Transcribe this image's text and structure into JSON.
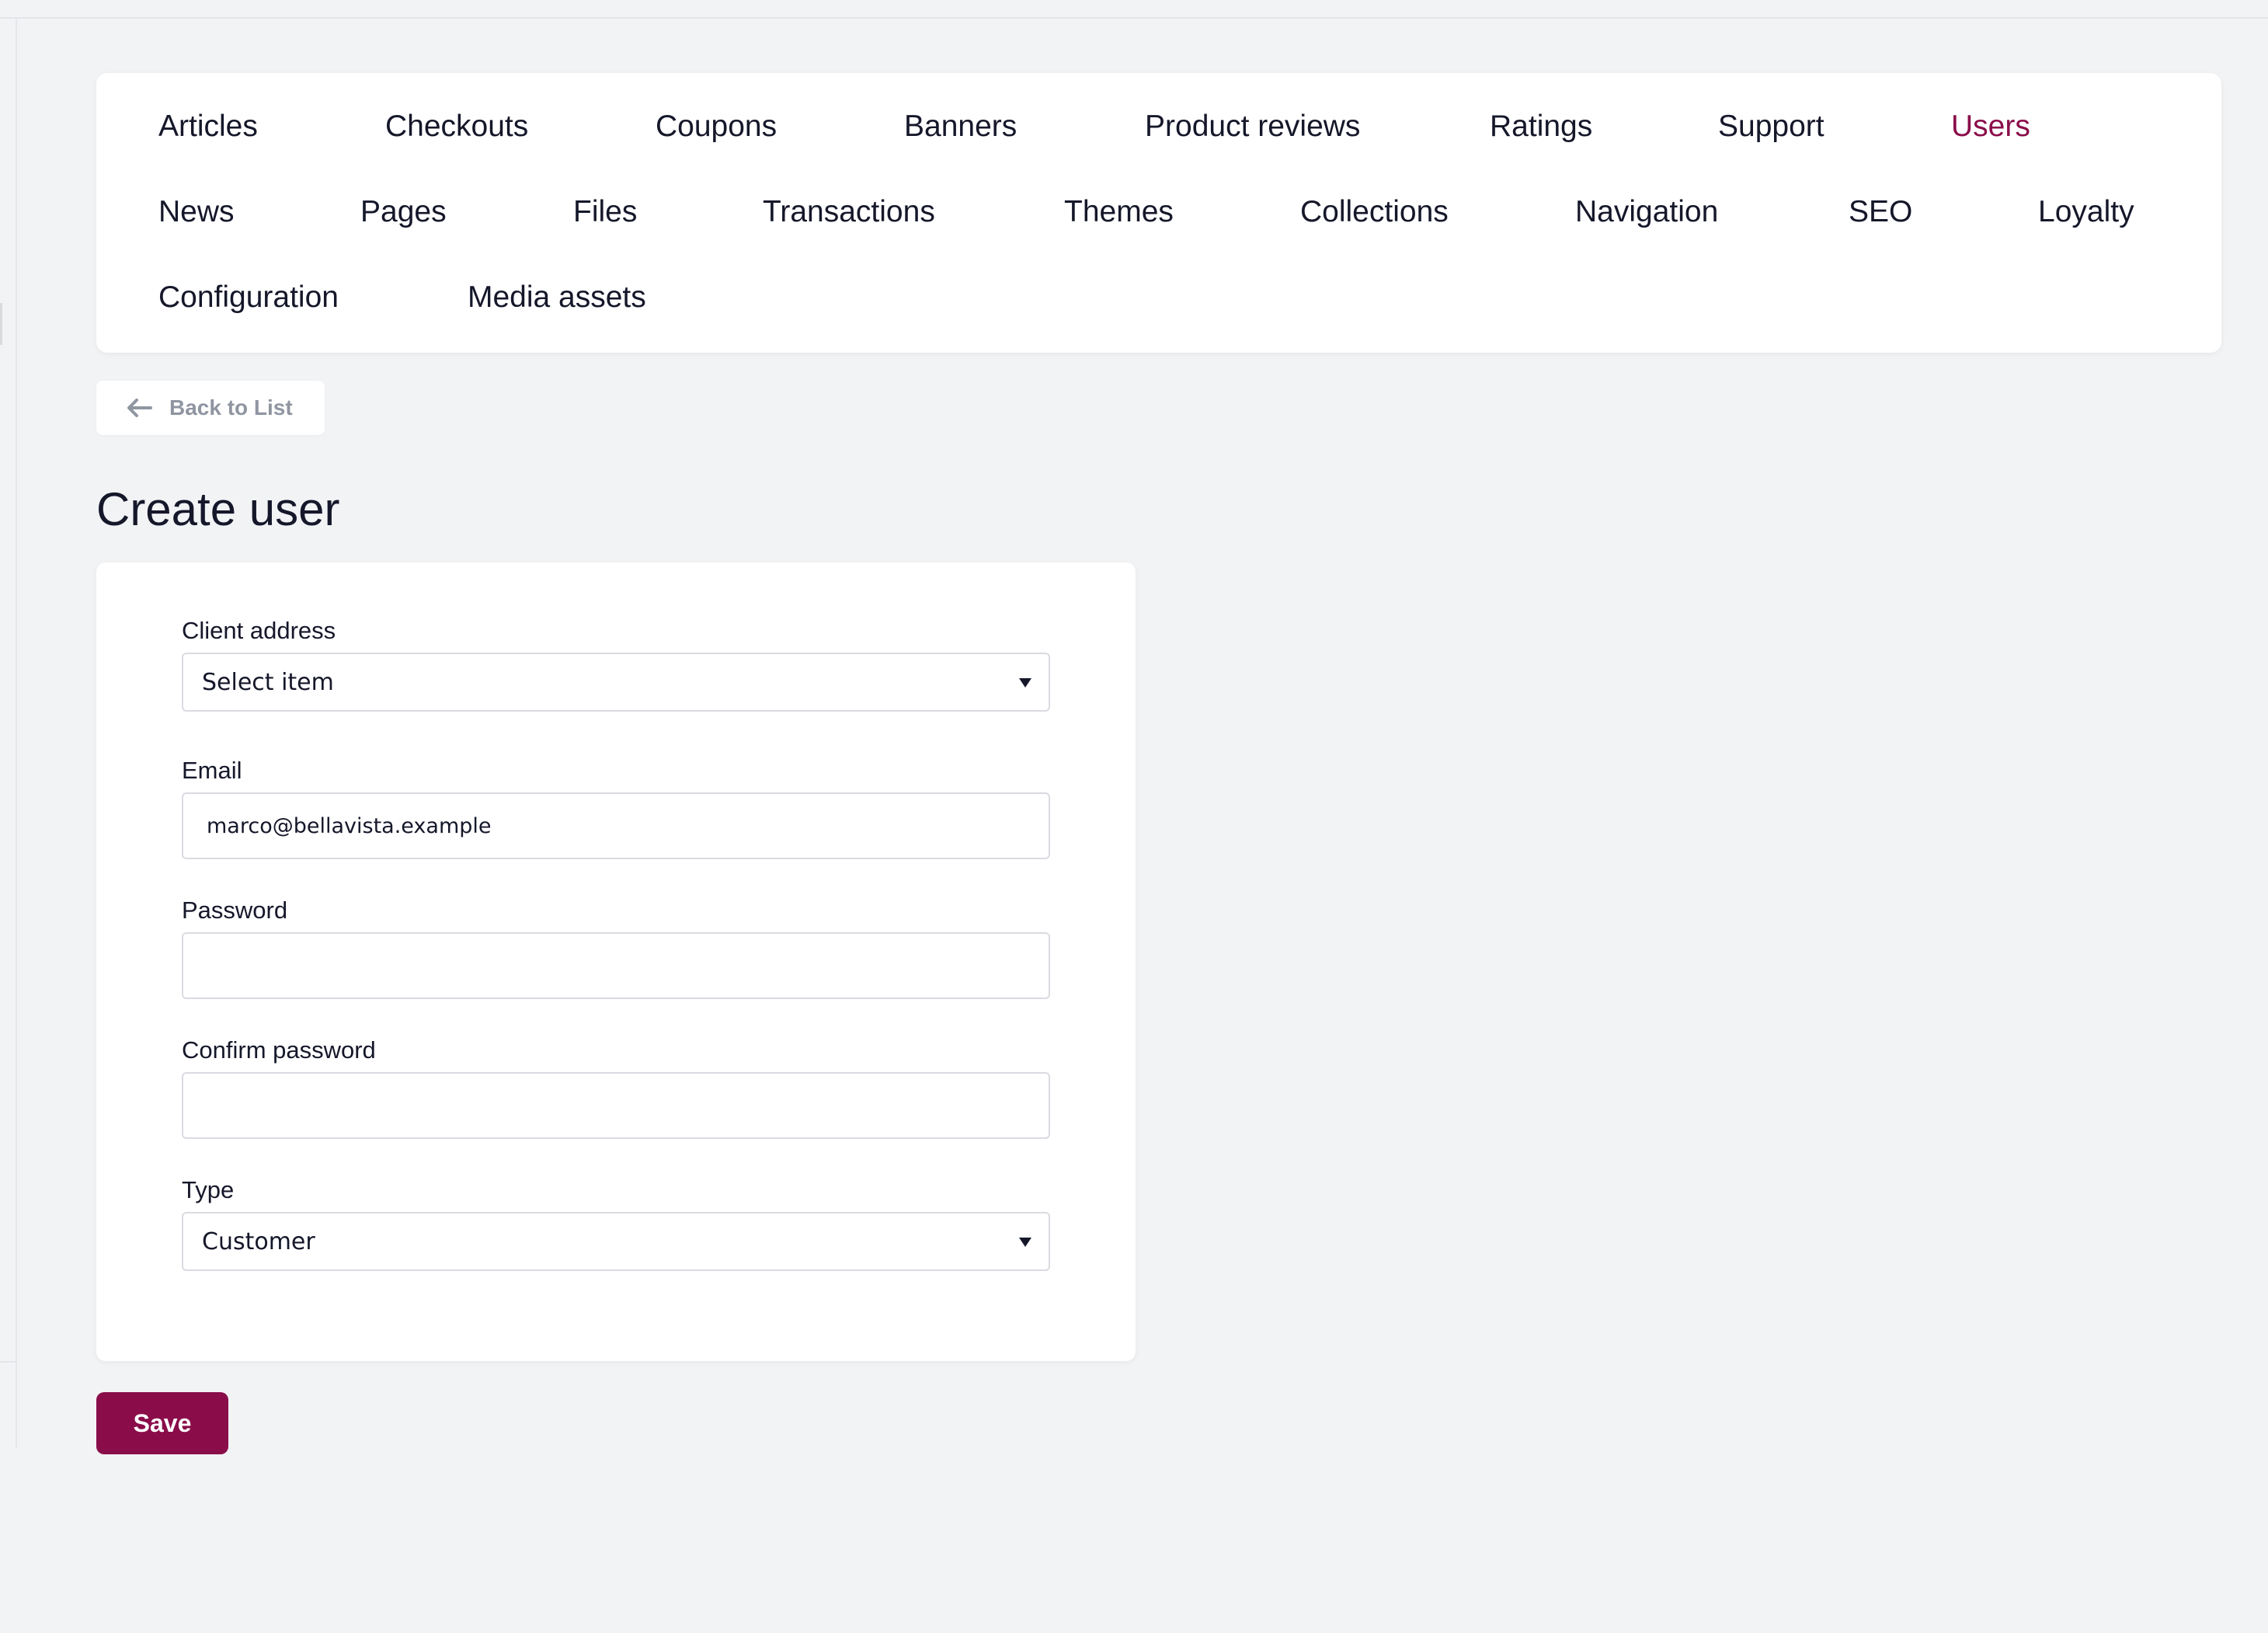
{
  "nav": {
    "items": [
      {
        "label": "Articles"
      },
      {
        "label": "Checkouts"
      },
      {
        "label": "Coupons"
      },
      {
        "label": "Banners"
      },
      {
        "label": "Product reviews"
      },
      {
        "label": "Ratings"
      },
      {
        "label": "Support"
      },
      {
        "label": "Users",
        "active": true
      },
      {
        "label": "News"
      },
      {
        "label": "Pages"
      },
      {
        "label": "Files"
      },
      {
        "label": "Transactions"
      },
      {
        "label": "Themes"
      },
      {
        "label": "Collections"
      },
      {
        "label": "Navigation"
      },
      {
        "label": "SEO"
      },
      {
        "label": "Loyalty"
      },
      {
        "label": "Configuration"
      },
      {
        "label": "Media assets"
      }
    ]
  },
  "back_button": {
    "label": "Back to List",
    "icon": "arrow-left-icon"
  },
  "page": {
    "title": "Create user"
  },
  "form": {
    "client_address": {
      "label": "Client address",
      "value": "Select item"
    },
    "email": {
      "label": "Email",
      "value": "marco@bellavista.example"
    },
    "password": {
      "label": "Password",
      "value": ""
    },
    "confirm_password": {
      "label": "Confirm password",
      "value": ""
    },
    "type": {
      "label": "Type",
      "value": "Customer"
    }
  },
  "save_button": {
    "label": "Save"
  },
  "colors": {
    "accent": "#8a0d4a",
    "background": "#f2f3f5",
    "card": "#ffffff",
    "muted": "#8f95a1"
  }
}
